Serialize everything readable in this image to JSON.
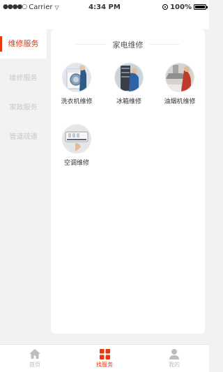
{
  "status_bar": {
    "signal": "●●●●○",
    "carrier": "Carrier",
    "wifi": "▽",
    "time": "4:34 PM",
    "battery": "100%"
  },
  "sidebar": {
    "items": [
      {
        "label": "维修服务",
        "active": true
      },
      {
        "label": "维修服务",
        "active": false
      },
      {
        "label": "家政服务",
        "active": false
      },
      {
        "label": "管道疏通",
        "active": false
      }
    ]
  },
  "content": {
    "section_title": "家电维修",
    "services": [
      {
        "label": "洗衣机维修",
        "icon": "washing-machine-icon"
      },
      {
        "label": "冰箱维修",
        "icon": "fridge-icon"
      },
      {
        "label": "油烟机维修",
        "icon": "range-hood-icon"
      },
      {
        "label": "空调维修",
        "icon": "air-conditioner-icon"
      }
    ]
  },
  "tabbar": {
    "items": [
      {
        "label": "首页",
        "icon": "home-icon",
        "active": false
      },
      {
        "label": "找服务",
        "icon": "grid-icon",
        "active": true
      },
      {
        "label": "我的",
        "icon": "user-icon",
        "active": false
      }
    ]
  },
  "colors": {
    "accent": "#e8380d",
    "background": "#f2f2f2",
    "card": "#ffffff"
  }
}
